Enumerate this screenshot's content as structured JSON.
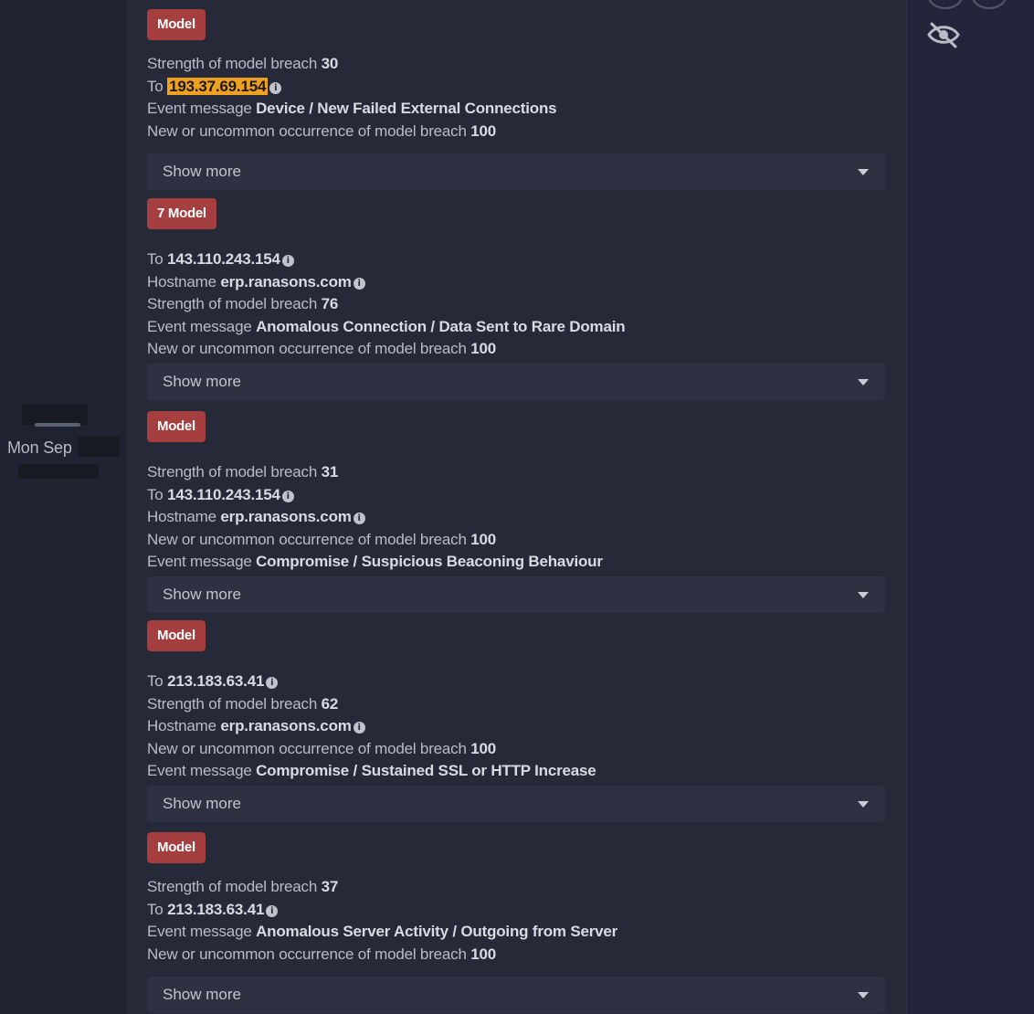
{
  "date_gutter": {
    "label": "Mon Sep"
  },
  "show_more_label": "Show more",
  "cards": [
    {
      "badge": "Model",
      "lines": [
        {
          "key": "Strength of model breach",
          "value": "30"
        },
        {
          "key": "To",
          "value": "193.37.69.154",
          "highlight": true,
          "info": true
        },
        {
          "key": "Event message",
          "value": "Device / New Failed External Connections"
        },
        {
          "key": "New or uncommon occurrence of model breach",
          "value": "100"
        }
      ]
    },
    {
      "badge": "7 Model",
      "lines": [
        {
          "key": "To",
          "value": "143.110.243.154",
          "info": true
        },
        {
          "key": "Hostname",
          "value": "erp.ranasons.com",
          "info": true
        },
        {
          "key": "Strength of model breach",
          "value": "76"
        },
        {
          "key": "Event message",
          "value": "Anomalous Connection / Data Sent to Rare Domain"
        },
        {
          "key": "New or uncommon occurrence of model breach",
          "value": "100"
        }
      ]
    },
    {
      "badge": "Model",
      "lines": [
        {
          "key": "Strength of model breach",
          "value": "31"
        },
        {
          "key": "To",
          "value": "143.110.243.154",
          "info": true
        },
        {
          "key": "Hostname",
          "value": "erp.ranasons.com",
          "info": true
        },
        {
          "key": "New or uncommon occurrence of model breach",
          "value": "100"
        },
        {
          "key": "Event message",
          "value": "Compromise / Suspicious Beaconing Behaviour"
        }
      ]
    },
    {
      "badge": "Model",
      "lines": [
        {
          "key": "To",
          "value": "213.183.63.41",
          "info": true
        },
        {
          "key": "Strength of model breach",
          "value": "62"
        },
        {
          "key": "Hostname",
          "value": "erp.ranasons.com",
          "info": true
        },
        {
          "key": "New or uncommon occurrence of model breach",
          "value": "100"
        },
        {
          "key": "Event message",
          "value": "Compromise / Sustained SSL or HTTP Increase"
        }
      ]
    },
    {
      "badge": "Model",
      "lines": [
        {
          "key": "Strength of model breach",
          "value": "37"
        },
        {
          "key": "To",
          "value": "213.183.63.41",
          "info": true
        },
        {
          "key": "Event message",
          "value": "Anomalous Server Activity / Outgoing from Server"
        },
        {
          "key": "New or uncommon occurrence of model breach",
          "value": "100"
        }
      ]
    }
  ]
}
